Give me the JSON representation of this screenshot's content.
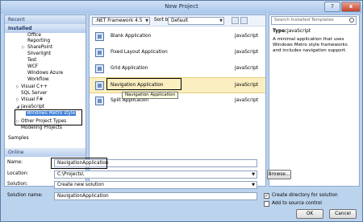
{
  "window": {
    "title": "New Project",
    "help_label": "?",
    "close_label": "x"
  },
  "left_panel": {
    "header": "Recent",
    "installed": "Installed",
    "items": [
      "Office",
      "Reporting",
      "SharePoint",
      "Silverlight",
      "Test",
      "WCF",
      "Windows Azure",
      "Workflow",
      "Visual C++",
      "SQL Server",
      "Visual F#",
      "JavaScript",
      "Windows Metro style",
      "Other Project Types",
      "Modeling Projects",
      "Samples"
    ],
    "online_header": "Online"
  },
  "toolbar": {
    "framework": ".NET Framework 4.5",
    "sort_label": "Sort by:",
    "sort_value": "Default"
  },
  "templates": [
    {
      "name": "Blank Application",
      "lang": "JavaScript"
    },
    {
      "name": "Fixed Layout Application",
      "lang": "JavaScript"
    },
    {
      "name": "Grid Application",
      "lang": "JavaScript"
    },
    {
      "name": "Navigation Application",
      "lang": "JavaScript"
    },
    {
      "name": "Split Application",
      "lang": "JavaScript"
    }
  ],
  "tooltip": "Navigation Application",
  "right_panel": {
    "search_placeholder": "Search Installed Templates",
    "type_label": "Type:",
    "type_value": "JavaScript",
    "description": "A minimal application that uses Windows Metro style frameworks and includes navigation support."
  },
  "form": {
    "name_label": "Name:",
    "name_value": "NavigationApplication",
    "location_label": "Location:",
    "location_value": "C:\\Projects\\",
    "browse_label": "Browse...",
    "solution_label": "Solution:",
    "solution_value": "Create new solution",
    "solution_name_label": "Solution name:",
    "solution_name_value": "NavigationApplication",
    "create_dir_label": "Create directory for solution",
    "create_dir_checked": true,
    "source_control_label": "Add to source control",
    "source_control_checked": false,
    "ok_label": "OK",
    "cancel_label": "Cancel"
  }
}
